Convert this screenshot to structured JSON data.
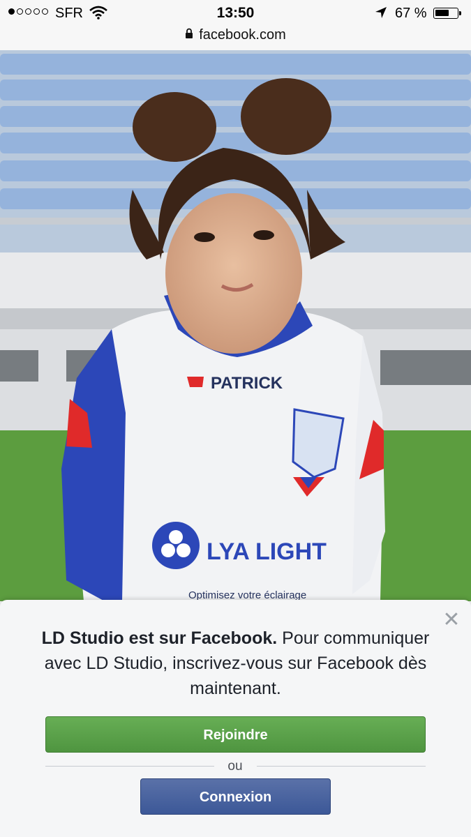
{
  "status_bar": {
    "carrier": "SFR",
    "time": "13:50",
    "battery_percent": "67 %",
    "battery_level": 0.67,
    "signal_bars": 1,
    "signal_total": 5
  },
  "url_bar": {
    "url": "facebook.com"
  },
  "photo": {
    "jersey_brand": "PATRICK",
    "jersey_sponsor": "LYA LIGHT",
    "jersey_tagline": "Optimisez votre éclairage"
  },
  "prompt": {
    "title": "LD Studio est sur Facebook.",
    "body": " Pour communiquer avec LD Studio, inscrivez-vous sur Facebook dès maintenant."
  },
  "buttons": {
    "join_label": "Rejoindre",
    "or_label": "ou",
    "login_label": "Connexion"
  },
  "colors": {
    "join_green": "#4f9540",
    "login_blue": "#3c5898"
  }
}
